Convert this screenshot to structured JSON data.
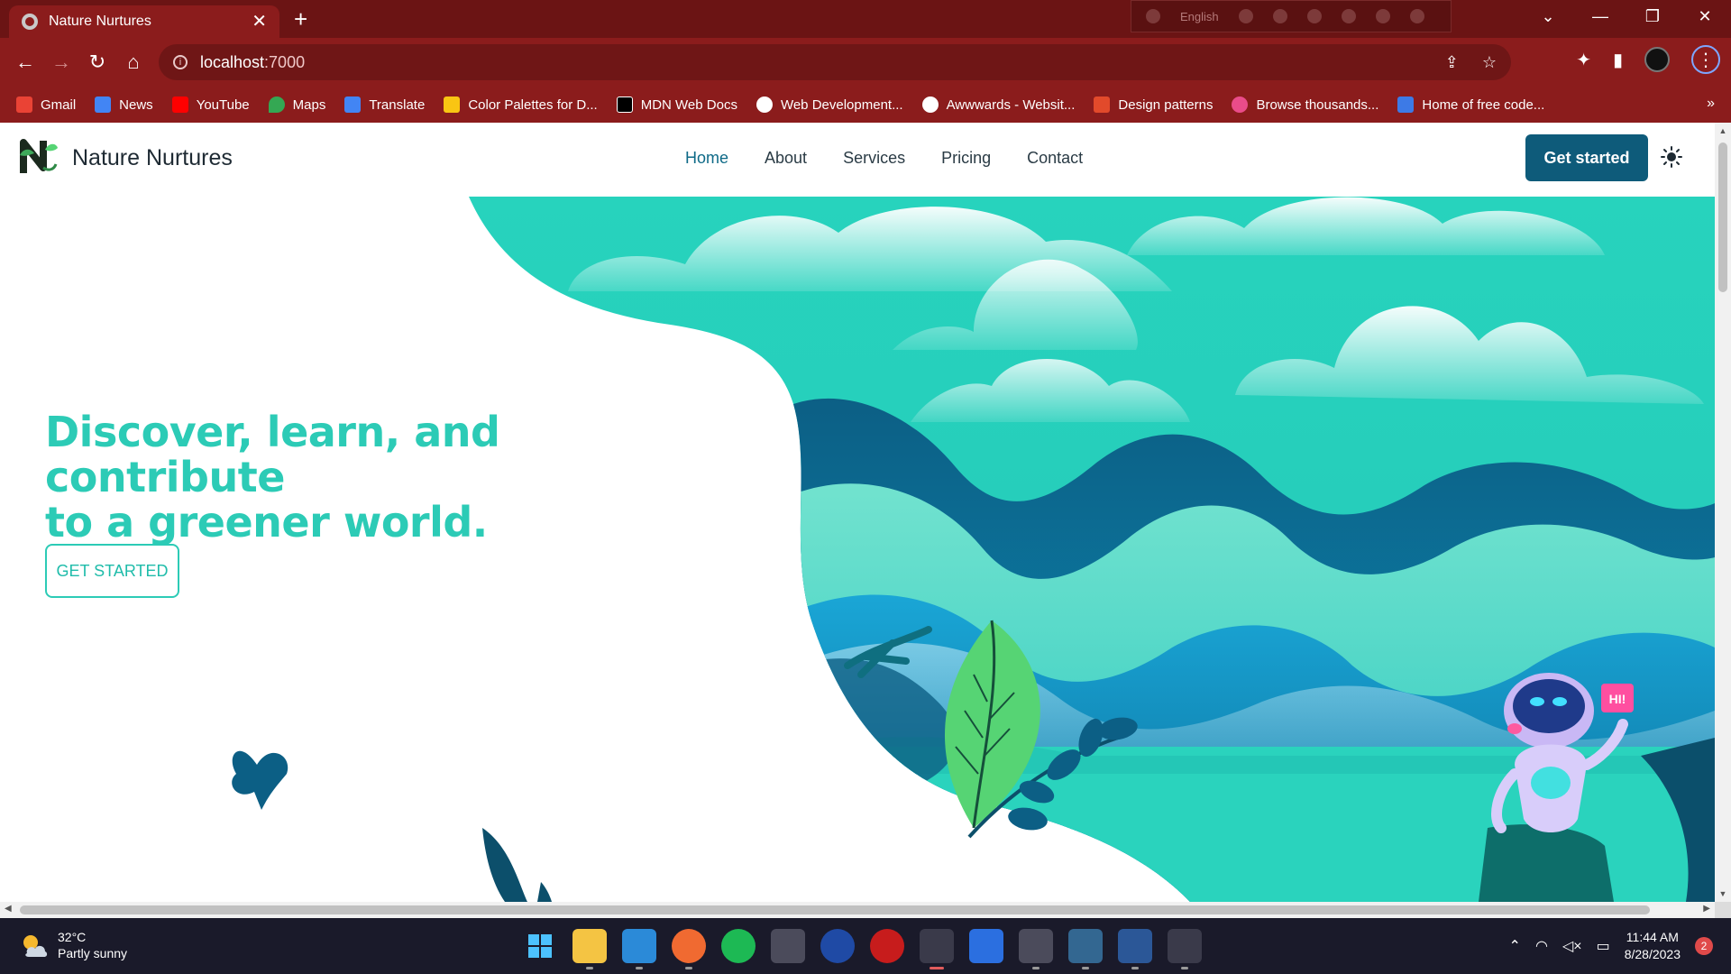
{
  "browser": {
    "tab_title": "Nature Nurtures",
    "tab_close": "✕",
    "new_tab": "+",
    "extension_language": "English",
    "window_controls": [
      "⌄",
      "—",
      "❐",
      "✕"
    ],
    "url_host": "localhost",
    "url_port": ":7000",
    "nav": {
      "back": "←",
      "forward": "→",
      "reload": "↻",
      "home": "⌂"
    },
    "bookmarks": [
      {
        "label": "Gmail",
        "color": "#ea4335"
      },
      {
        "label": "News",
        "color": "#4285f4"
      },
      {
        "label": "YouTube",
        "color": "#ff0000"
      },
      {
        "label": "Maps",
        "color": "#34a853"
      },
      {
        "label": "Translate",
        "color": "#4285f4"
      },
      {
        "label": "Color Palettes for D...",
        "color": "#f9c513"
      },
      {
        "label": "MDN Web Docs",
        "color": "#000000"
      },
      {
        "label": "Web Development...",
        "color": "#ffffff"
      },
      {
        "label": "Awwwards - Websit...",
        "color": "#ffffff"
      },
      {
        "label": "Design patterns",
        "color": "#e24a2b"
      },
      {
        "label": "Browse thousands...",
        "color": "#ea4c89"
      },
      {
        "label": "Home of free code...",
        "color": "#3d7ae6"
      }
    ],
    "bookmarks_more": "»"
  },
  "site": {
    "brand": "Nature Nurtures",
    "nav": [
      "Home",
      "About",
      "Services",
      "Pricing",
      "Contact"
    ],
    "cta": "Get started",
    "hero_title_line1": "Discover, learn, and contribute",
    "hero_title_line2": "to a greener world.",
    "hero_button": "GET STARTED",
    "robot_sign": "HI!",
    "colors": {
      "accent": "#2ccbb6",
      "cta": "#0e5b7a",
      "nav_active": "#0e6a87",
      "teal_light": "#27d3bd",
      "teal_dark": "#0c5f85",
      "leaf_green": "#56d474"
    }
  },
  "taskbar": {
    "temperature": "32°C",
    "weather": "Partly sunny",
    "time": "11:44 AM",
    "date": "8/28/2023",
    "notifications": "2",
    "apps": [
      {
        "name": "start",
        "color": "#1e8fff"
      },
      {
        "name": "file-explorer",
        "color": "#f4c443"
      },
      {
        "name": "vscode",
        "color": "#2b8ad8"
      },
      {
        "name": "postman",
        "color": "#f06a31"
      },
      {
        "name": "spotify",
        "color": "#1db954"
      },
      {
        "name": "git",
        "color": "#4b4b5b"
      },
      {
        "name": "ccleaner",
        "color": "#1f4aa5"
      },
      {
        "name": "antivirus",
        "color": "#c71c1c"
      },
      {
        "name": "chrome",
        "color": "#3a3a4a"
      },
      {
        "name": "todo",
        "color": "#2b6fe0"
      },
      {
        "name": "git-2",
        "color": "#4b4b5b"
      },
      {
        "name": "postgres",
        "color": "#336791"
      },
      {
        "name": "word",
        "color": "#2b5797"
      },
      {
        "name": "chrome-2",
        "color": "#3a3a4a"
      }
    ]
  }
}
